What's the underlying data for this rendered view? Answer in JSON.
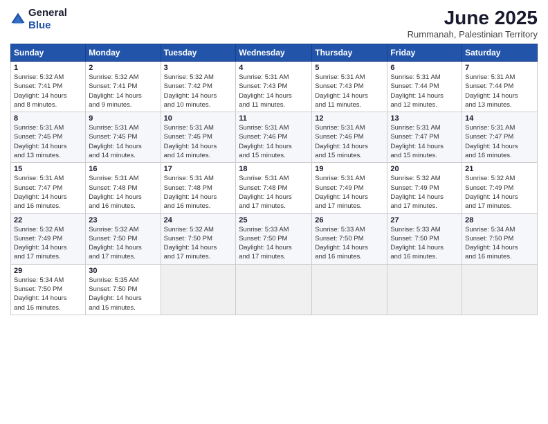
{
  "logo": {
    "general": "General",
    "blue": "Blue"
  },
  "header": {
    "title": "June 2025",
    "subtitle": "Rummanah, Palestinian Territory"
  },
  "columns": [
    "Sunday",
    "Monday",
    "Tuesday",
    "Wednesday",
    "Thursday",
    "Friday",
    "Saturday"
  ],
  "weeks": [
    [
      {
        "day": "1",
        "info": "Sunrise: 5:32 AM\nSunset: 7:41 PM\nDaylight: 14 hours\nand 8 minutes."
      },
      {
        "day": "2",
        "info": "Sunrise: 5:32 AM\nSunset: 7:41 PM\nDaylight: 14 hours\nand 9 minutes."
      },
      {
        "day": "3",
        "info": "Sunrise: 5:32 AM\nSunset: 7:42 PM\nDaylight: 14 hours\nand 10 minutes."
      },
      {
        "day": "4",
        "info": "Sunrise: 5:31 AM\nSunset: 7:43 PM\nDaylight: 14 hours\nand 11 minutes."
      },
      {
        "day": "5",
        "info": "Sunrise: 5:31 AM\nSunset: 7:43 PM\nDaylight: 14 hours\nand 11 minutes."
      },
      {
        "day": "6",
        "info": "Sunrise: 5:31 AM\nSunset: 7:44 PM\nDaylight: 14 hours\nand 12 minutes."
      },
      {
        "day": "7",
        "info": "Sunrise: 5:31 AM\nSunset: 7:44 PM\nDaylight: 14 hours\nand 13 minutes."
      }
    ],
    [
      {
        "day": "8",
        "info": "Sunrise: 5:31 AM\nSunset: 7:45 PM\nDaylight: 14 hours\nand 13 minutes."
      },
      {
        "day": "9",
        "info": "Sunrise: 5:31 AM\nSunset: 7:45 PM\nDaylight: 14 hours\nand 14 minutes."
      },
      {
        "day": "10",
        "info": "Sunrise: 5:31 AM\nSunset: 7:45 PM\nDaylight: 14 hours\nand 14 minutes."
      },
      {
        "day": "11",
        "info": "Sunrise: 5:31 AM\nSunset: 7:46 PM\nDaylight: 14 hours\nand 15 minutes."
      },
      {
        "day": "12",
        "info": "Sunrise: 5:31 AM\nSunset: 7:46 PM\nDaylight: 14 hours\nand 15 minutes."
      },
      {
        "day": "13",
        "info": "Sunrise: 5:31 AM\nSunset: 7:47 PM\nDaylight: 14 hours\nand 15 minutes."
      },
      {
        "day": "14",
        "info": "Sunrise: 5:31 AM\nSunset: 7:47 PM\nDaylight: 14 hours\nand 16 minutes."
      }
    ],
    [
      {
        "day": "15",
        "info": "Sunrise: 5:31 AM\nSunset: 7:47 PM\nDaylight: 14 hours\nand 16 minutes."
      },
      {
        "day": "16",
        "info": "Sunrise: 5:31 AM\nSunset: 7:48 PM\nDaylight: 14 hours\nand 16 minutes."
      },
      {
        "day": "17",
        "info": "Sunrise: 5:31 AM\nSunset: 7:48 PM\nDaylight: 14 hours\nand 16 minutes."
      },
      {
        "day": "18",
        "info": "Sunrise: 5:31 AM\nSunset: 7:48 PM\nDaylight: 14 hours\nand 17 minutes."
      },
      {
        "day": "19",
        "info": "Sunrise: 5:31 AM\nSunset: 7:49 PM\nDaylight: 14 hours\nand 17 minutes."
      },
      {
        "day": "20",
        "info": "Sunrise: 5:32 AM\nSunset: 7:49 PM\nDaylight: 14 hours\nand 17 minutes."
      },
      {
        "day": "21",
        "info": "Sunrise: 5:32 AM\nSunset: 7:49 PM\nDaylight: 14 hours\nand 17 minutes."
      }
    ],
    [
      {
        "day": "22",
        "info": "Sunrise: 5:32 AM\nSunset: 7:49 PM\nDaylight: 14 hours\nand 17 minutes."
      },
      {
        "day": "23",
        "info": "Sunrise: 5:32 AM\nSunset: 7:50 PM\nDaylight: 14 hours\nand 17 minutes."
      },
      {
        "day": "24",
        "info": "Sunrise: 5:32 AM\nSunset: 7:50 PM\nDaylight: 14 hours\nand 17 minutes."
      },
      {
        "day": "25",
        "info": "Sunrise: 5:33 AM\nSunset: 7:50 PM\nDaylight: 14 hours\nand 17 minutes."
      },
      {
        "day": "26",
        "info": "Sunrise: 5:33 AM\nSunset: 7:50 PM\nDaylight: 14 hours\nand 16 minutes."
      },
      {
        "day": "27",
        "info": "Sunrise: 5:33 AM\nSunset: 7:50 PM\nDaylight: 14 hours\nand 16 minutes."
      },
      {
        "day": "28",
        "info": "Sunrise: 5:34 AM\nSunset: 7:50 PM\nDaylight: 14 hours\nand 16 minutes."
      }
    ],
    [
      {
        "day": "29",
        "info": "Sunrise: 5:34 AM\nSunset: 7:50 PM\nDaylight: 14 hours\nand 16 minutes."
      },
      {
        "day": "30",
        "info": "Sunrise: 5:35 AM\nSunset: 7:50 PM\nDaylight: 14 hours\nand 15 minutes."
      },
      {
        "day": "",
        "info": ""
      },
      {
        "day": "",
        "info": ""
      },
      {
        "day": "",
        "info": ""
      },
      {
        "day": "",
        "info": ""
      },
      {
        "day": "",
        "info": ""
      }
    ]
  ]
}
